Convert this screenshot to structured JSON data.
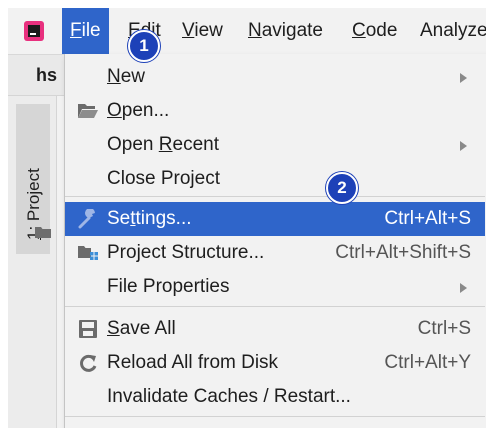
{
  "menubar": {
    "items": [
      {
        "pre": "",
        "mn": "F",
        "post": "ile"
      },
      {
        "pre": "",
        "mn": "E",
        "post": "dit"
      },
      {
        "pre": "",
        "mn": "V",
        "post": "iew"
      },
      {
        "pre": "",
        "mn": "N",
        "post": "avigate"
      },
      {
        "pre": "",
        "mn": "C",
        "post": "ode"
      },
      {
        "pre": "",
        "mn": "",
        "post": "Analyze"
      }
    ]
  },
  "project_bar": {
    "text": "hs"
  },
  "side_panel": {
    "num": "1",
    "sep": ": ",
    "label": "Project"
  },
  "file_menu": {
    "new": {
      "pre": "",
      "mn": "N",
      "post": "ew"
    },
    "open": {
      "pre": "",
      "mn": "O",
      "post": "pen..."
    },
    "open_recent": {
      "pre": "Open ",
      "mn": "R",
      "post": "ecent"
    },
    "close_project": {
      "pre": "Close Project",
      "mn": "",
      "post": ""
    },
    "settings": {
      "pre": "Se",
      "mn": "t",
      "post": "tings...",
      "shortcut": "Ctrl+Alt+S"
    },
    "project_structure": {
      "pre": "Project Structure...",
      "mn": "",
      "post": "",
      "shortcut": "Ctrl+Alt+Shift+S"
    },
    "file_properties": {
      "pre": "File Properties",
      "mn": "",
      "post": ""
    },
    "save_all": {
      "pre": "",
      "mn": "S",
      "post": "ave All",
      "shortcut": "Ctrl+S"
    },
    "reload": {
      "pre": "Reload All from Disk",
      "mn": "",
      "post": "",
      "shortcut": "Ctrl+Alt+Y"
    },
    "invalidate": {
      "pre": "Invalidate Caches / Restart...",
      "mn": "",
      "post": ""
    }
  },
  "steps": {
    "one": "1",
    "two": "2"
  },
  "colors": {
    "highlight": "#2f65ca",
    "step_badge": "#1d41b8"
  },
  "icons": [
    "app-logo-icon",
    "folder-open-icon",
    "wrench-icon",
    "project-structure-icon",
    "save-icon",
    "reload-icon",
    "folder-icon",
    "submenu-arrow-icon"
  ]
}
